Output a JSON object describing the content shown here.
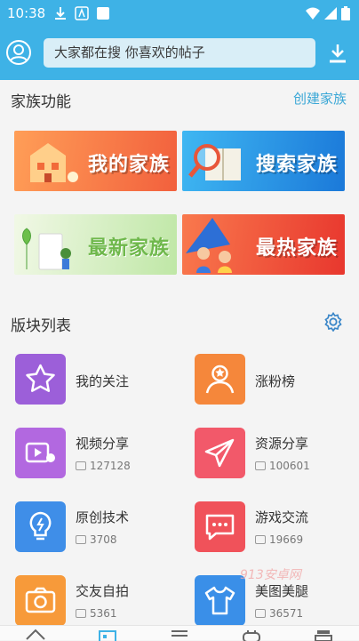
{
  "status": {
    "time": "10:38"
  },
  "header": {
    "search_placeholder": "大家都在搜 你喜欢的帖子"
  },
  "family": {
    "title": "家族功能",
    "create_label": "创建家族",
    "banners": [
      "我的家族",
      "搜索家族",
      "最新家族",
      "最热家族"
    ]
  },
  "blocks": {
    "title": "版块列表",
    "items": [
      {
        "label": "我的关注",
        "count": "",
        "color": "#9c5fd9",
        "icon": "star-icon"
      },
      {
        "label": "涨粉榜",
        "count": "",
        "color": "#f5873b",
        "icon": "profile-star-icon"
      },
      {
        "label": "视频分享",
        "count": "127128",
        "color": "#b268e0",
        "icon": "video-icon"
      },
      {
        "label": "资源分享",
        "count": "100601",
        "color": "#f2596a",
        "icon": "send-icon"
      },
      {
        "label": "原创技术",
        "count": "3708",
        "color": "#3f8ee8",
        "icon": "bulb-icon"
      },
      {
        "label": "游戏交流",
        "count": "19669",
        "color": "#f0525a",
        "icon": "chat-icon"
      },
      {
        "label": "交友自拍",
        "count": "5361",
        "color": "#f79a3a",
        "icon": "camera-icon"
      },
      {
        "label": "美图美腿",
        "count": "36571",
        "color": "#3a8fe8",
        "icon": "shirt-icon"
      }
    ]
  },
  "watermark": "913安卓网"
}
